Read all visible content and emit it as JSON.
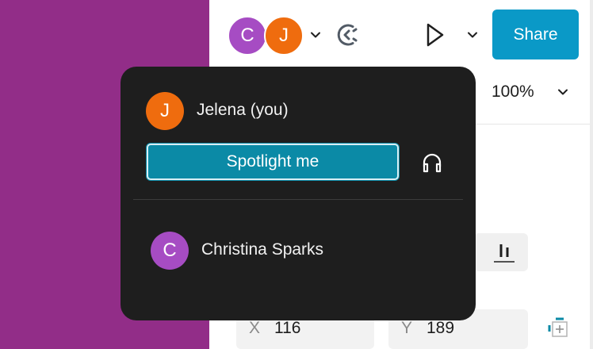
{
  "toolbar": {
    "collaborators": [
      {
        "initial": "C",
        "color": "#a64cc3"
      },
      {
        "initial": "J",
        "color": "#ef6c0e"
      }
    ],
    "share_label": "Share",
    "share_color": "#0a99c7"
  },
  "properties": {
    "zoom": "100%",
    "x_label": "X",
    "x_value": "116",
    "y_label": "Y",
    "y_value": "189"
  },
  "canvas": {
    "background": "#922d88"
  },
  "popover": {
    "me": {
      "initial": "J",
      "name": "Jelena (you)",
      "color": "#ef6c0e"
    },
    "spotlight_label": "Spotlight me",
    "others": [
      {
        "initial": "C",
        "name": "Christina Sparks",
        "color": "#a64cc3"
      }
    ]
  }
}
